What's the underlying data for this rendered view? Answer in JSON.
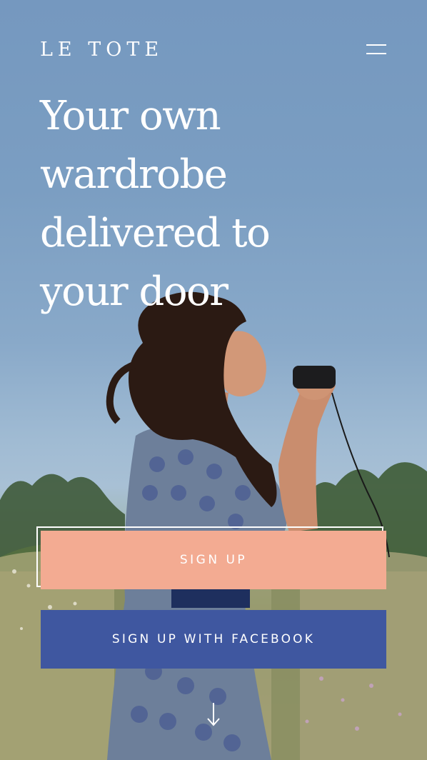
{
  "header": {
    "logo": "LE TOTE",
    "menu_icon": "hamburger-menu-icon"
  },
  "hero": {
    "headline_lines": [
      "Your own",
      "wardrobe",
      "delivered to",
      "your door"
    ]
  },
  "actions": {
    "signup_label": "SIGN UP",
    "facebook_label": "SIGN UP WITH FACEBOOK",
    "scroll_icon": "arrow-down-icon"
  },
  "colors": {
    "signup_bg": "#f3ab92",
    "facebook_bg": "#3f57a0",
    "sky": "#7b9ec2",
    "text": "#ffffff"
  }
}
